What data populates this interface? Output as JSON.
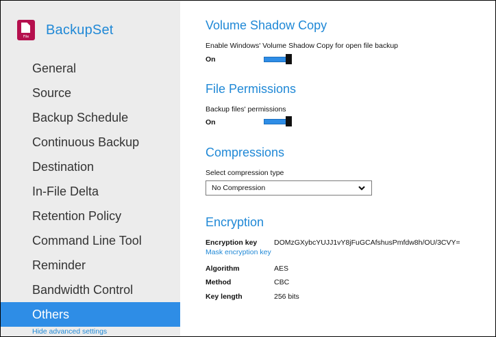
{
  "sidebar": {
    "title": "BackupSet",
    "icon_caption": "File",
    "items": [
      {
        "label": "General"
      },
      {
        "label": "Source"
      },
      {
        "label": "Backup Schedule"
      },
      {
        "label": "Continuous Backup"
      },
      {
        "label": "Destination"
      },
      {
        "label": "In-File Delta"
      },
      {
        "label": "Retention Policy"
      },
      {
        "label": "Command Line Tool"
      },
      {
        "label": "Reminder"
      },
      {
        "label": "Bandwidth Control"
      },
      {
        "label": "Others",
        "active": true
      }
    ],
    "hide_advanced": "Hide advanced settings"
  },
  "vss": {
    "title": "Volume Shadow Copy",
    "label": "Enable Windows' Volume Shadow Copy for open file backup",
    "state": "On"
  },
  "permissions": {
    "title": "File Permissions",
    "label": "Backup files' permissions",
    "state": "On"
  },
  "compression": {
    "title": "Compressions",
    "label": "Select compression type",
    "selected": "No Compression"
  },
  "encryption": {
    "title": "Encryption",
    "key_label": "Encryption key",
    "key_value": "DOMzGXybcYUJJ1vY8jFuGCAfshusPmfdw8h/OU/3CVY=",
    "mask_link": "Mask encryption key",
    "algorithm_label": "Algorithm",
    "algorithm_value": "AES",
    "method_label": "Method",
    "method_value": "CBC",
    "key_length_label": "Key length",
    "key_length_value": "256 bits"
  },
  "colors": {
    "accent": "#1f88d6",
    "active_bg": "#2e8de6",
    "sidebar_bg": "#ececec",
    "brand_icon": "#b5104e"
  },
  "icons": {
    "backupset": "file-document-icon",
    "dropdown": "chevron-down-icon"
  }
}
